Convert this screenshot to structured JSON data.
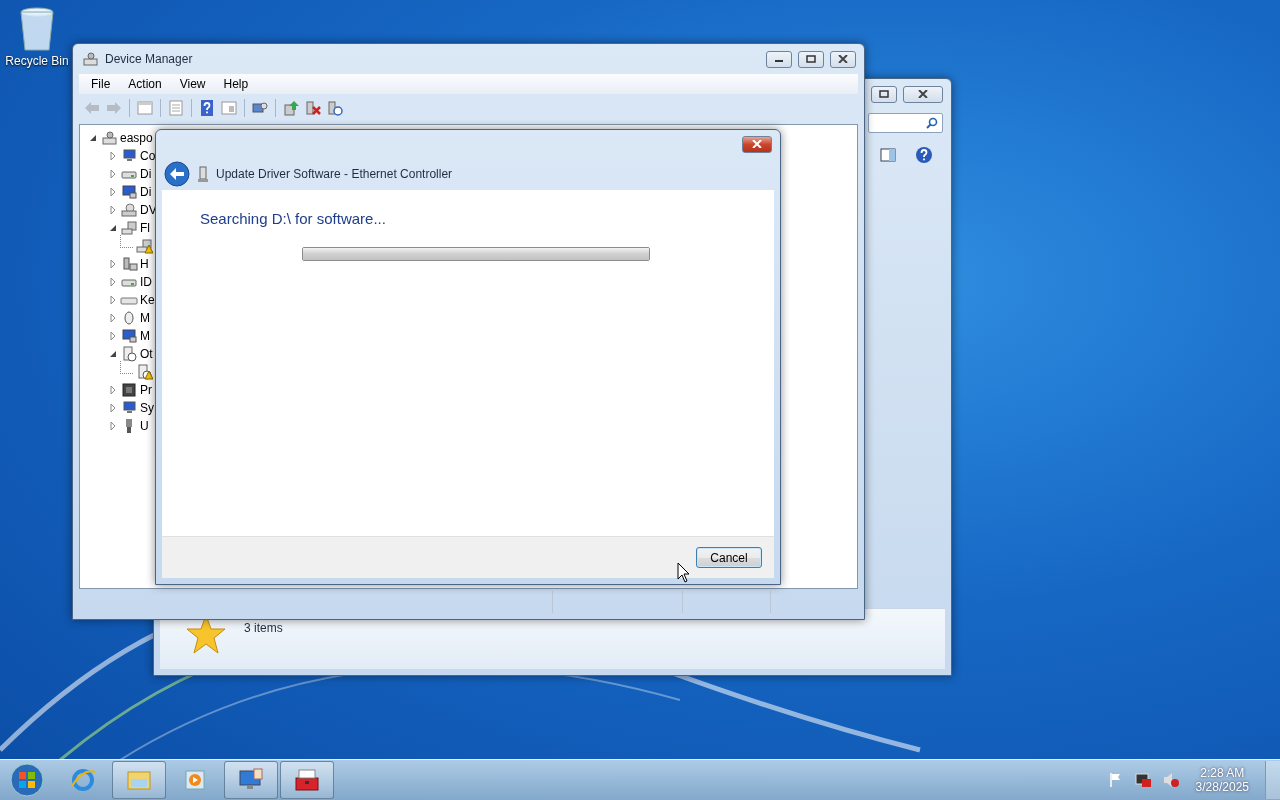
{
  "desktop": {
    "icons": [
      {
        "kind": "recycle-bin",
        "label": "Recycle Bin"
      }
    ]
  },
  "back_window": {
    "details": {
      "text": "3 items"
    }
  },
  "device_manager": {
    "title": "Device Manager",
    "menu": [
      "File",
      "Action",
      "View",
      "Help"
    ],
    "tree": {
      "label": "easpo",
      "expanded": true,
      "children": [
        {
          "kind": "computer",
          "label": "Co",
          "expanded": false
        },
        {
          "kind": "drive",
          "label": "Di",
          "expanded": false
        },
        {
          "kind": "display",
          "label": "Di",
          "expanded": false
        },
        {
          "kind": "dvd",
          "label": "DV",
          "expanded": false
        },
        {
          "kind": "floppy",
          "label": "Fl",
          "expanded": true,
          "children": [
            {
              "kind": "floppy",
              "warning": true
            }
          ]
        },
        {
          "kind": "hid",
          "label": "H",
          "expanded": false
        },
        {
          "kind": "drive",
          "label": "ID",
          "expanded": false
        },
        {
          "kind": "keyboard",
          "label": "Ke",
          "expanded": false
        },
        {
          "kind": "mouse",
          "label": "M",
          "expanded": false
        },
        {
          "kind": "display",
          "label": "M",
          "expanded": false
        },
        {
          "kind": "other",
          "label": "Ot",
          "expanded": true,
          "children": [
            {
              "kind": "other",
              "warning": true
            }
          ]
        },
        {
          "kind": "chip",
          "label": "Pr",
          "expanded": false
        },
        {
          "kind": "computer",
          "label": "Sy",
          "expanded": false
        },
        {
          "kind": "usb",
          "label": "U",
          "expanded": false
        }
      ]
    }
  },
  "dialog": {
    "title": "Update Driver Software - Ethernet Controller",
    "heading": "Searching D:\\ for software...",
    "progress": {
      "level": 1
    },
    "buttons": [
      "Cancel"
    ]
  },
  "taskbar": {
    "apps": [
      {
        "kind": "browser",
        "running": false
      },
      {
        "kind": "folder",
        "running": true
      },
      {
        "kind": "media",
        "running": false
      },
      {
        "kind": "monitor",
        "running": true
      },
      {
        "kind": "toolbox",
        "running": true
      }
    ],
    "clock": {
      "time": "2:28 AM",
      "date": "3/28/2025"
    }
  }
}
